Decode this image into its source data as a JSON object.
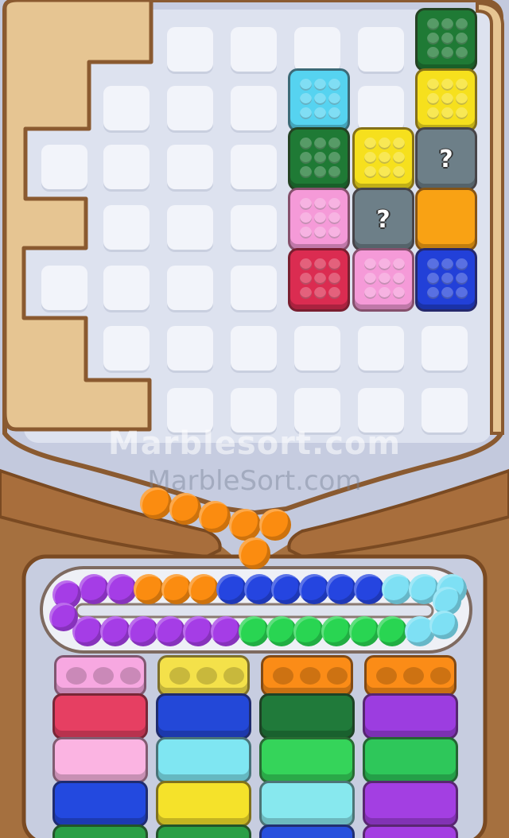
{
  "watermark": {
    "primary": "Marblesort.com",
    "secondary": "MarbleSort.com"
  },
  "board": {
    "block_icon": "studded-block-icon",
    "mystery_label": "?",
    "blocks": [
      {
        "col": 6,
        "row": 0,
        "color": "#1f7a35",
        "kind": "studs"
      },
      {
        "col": 4,
        "row": 1,
        "color": "#56d3f0",
        "kind": "studs"
      },
      {
        "col": 6,
        "row": 1,
        "color": "#f6e01d",
        "kind": "studs"
      },
      {
        "col": 4,
        "row": 2,
        "color": "#1f7a35",
        "kind": "studs"
      },
      {
        "col": 5,
        "row": 2,
        "color": "#f6e01d",
        "kind": "studs"
      },
      {
        "col": 6,
        "row": 2,
        "color": "#6d7f88",
        "kind": "mystery"
      },
      {
        "col": 4,
        "row": 3,
        "color": "#f59ad8",
        "kind": "studs"
      },
      {
        "col": 5,
        "row": 3,
        "color": "#6d7f88",
        "kind": "mystery"
      },
      {
        "col": 6,
        "row": 3,
        "color": "#f9a214",
        "kind": "plain"
      },
      {
        "col": 4,
        "row": 4,
        "color": "#db2c51",
        "kind": "studs"
      },
      {
        "col": 5,
        "row": 4,
        "color": "#f59ad8",
        "kind": "studs"
      },
      {
        "col": 6,
        "row": 4,
        "color": "#2240d8",
        "kind": "studs"
      }
    ]
  },
  "marbles": {
    "falling_color": "#fb8c10",
    "falling_count": 6,
    "track_top": [
      "#a53de6",
      "#a53de6",
      "#fb8c10",
      "#fb8c10",
      "#fb8c10",
      "#2545e0",
      "#2545e0",
      "#2545e0",
      "#2545e0",
      "#2545e0",
      "#2545e0",
      "#7ee0f4",
      "#7ee0f4",
      "#7ee0f4"
    ],
    "track_bottom": [
      "#a53de6",
      "#a53de6",
      "#a53de6",
      "#a53de6",
      "#a53de6",
      "#a53de6",
      "#29d552",
      "#29d552",
      "#29d552",
      "#29d552",
      "#29d552",
      "#29d552",
      "#7ee0f4"
    ],
    "track_end_color": "#7ee0f4"
  },
  "tubes": [
    {
      "cap": "#f7a8e1",
      "stack": [
        "#e63f62",
        "#fbb4e2",
        "#2349df",
        "#2a9f45"
      ]
    },
    {
      "cap": "#f4e14a",
      "stack": [
        "#2348d8",
        "#7fe6f2",
        "#f5e22a",
        "#2a9f45"
      ]
    },
    {
      "cap": "#fb8c17",
      "stack": [
        "#207a3a",
        "#35d45a",
        "#87e8ee",
        "#2750dd"
      ]
    },
    {
      "cap": "#fb8c17",
      "stack": [
        "#9c3de0",
        "#2ec75a",
        "#a33fe2",
        "#a33fe2"
      ]
    }
  ]
}
